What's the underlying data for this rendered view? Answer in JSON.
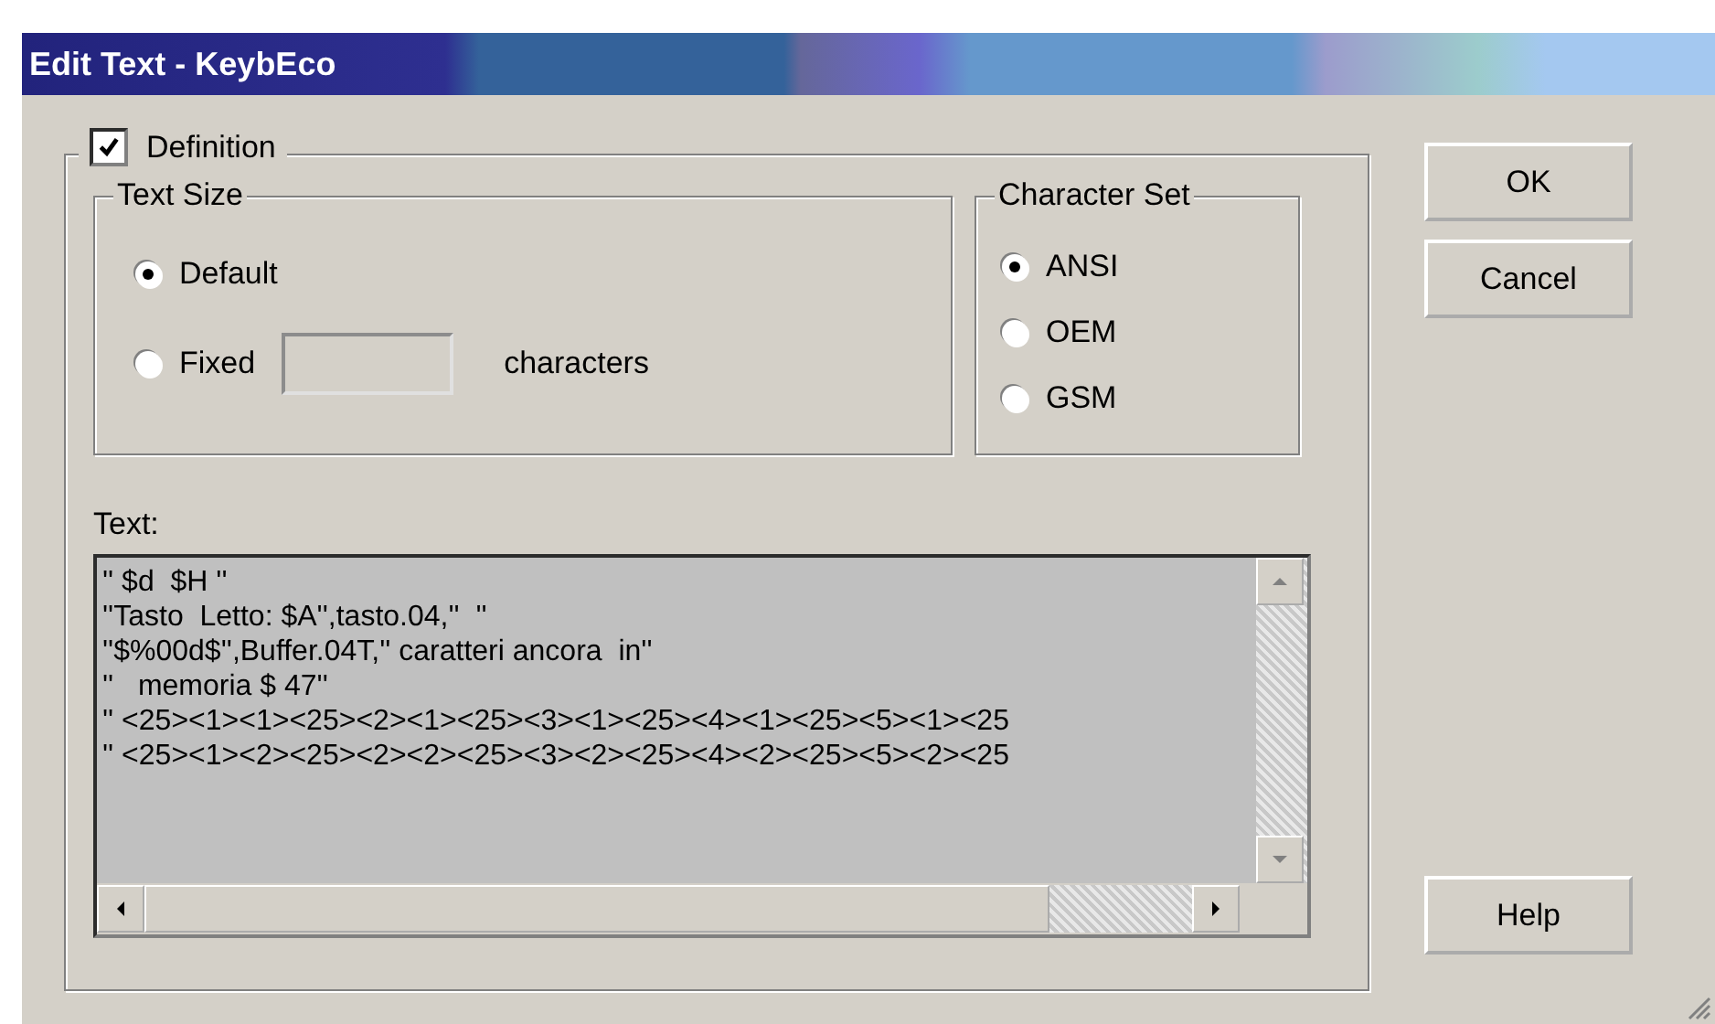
{
  "window": {
    "title": "Edit Text - KeybEco"
  },
  "definition": {
    "label": "Definition",
    "checked": true
  },
  "text_size": {
    "title": "Text Size",
    "options": [
      {
        "label": "Default",
        "selected": true
      },
      {
        "label": "Fixed",
        "selected": false
      }
    ],
    "unit": "characters"
  },
  "character_set": {
    "title": "Character Set",
    "options": [
      {
        "label": "ANSI",
        "selected": true
      },
      {
        "label": "OEM",
        "selected": false
      },
      {
        "label": "GSM",
        "selected": false
      }
    ]
  },
  "text": {
    "label": "Text:",
    "lines": [
      "'' $d  $H ''",
      "''Tasto  Letto: $A'',tasto.04,''  ''",
      "''$%00d$'',Buffer.04T,'' caratteri ancora  in''",
      "''   memoria $ 47''",
      "'' <25><1><1><25><2><1><25><3><1><25><4><1><25><5><1><25",
      "'' <25><1><2><25><2><2><25><3><2><25><4><2><25><5><2><25"
    ]
  },
  "buttons": [
    "OK",
    "Cancel",
    "Help"
  ]
}
